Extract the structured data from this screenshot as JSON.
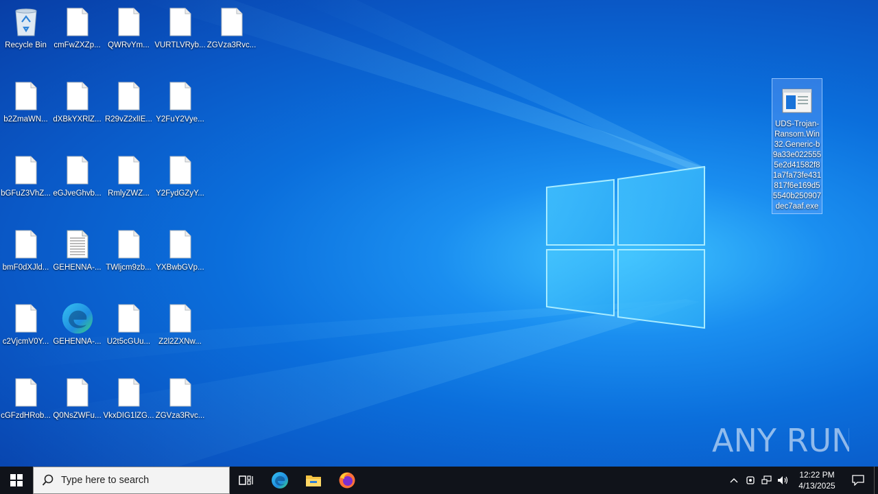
{
  "desktop": {
    "icons": [
      {
        "label": "Recycle Bin",
        "type": "recycle"
      },
      {
        "label": "cmFwZXZp...",
        "type": "file"
      },
      {
        "label": "QWRvYm...",
        "type": "file"
      },
      {
        "label": "VURTLVRyb...",
        "type": "file"
      },
      {
        "label": "ZGVza3Rvc...",
        "type": "file"
      },
      {
        "label": "b2ZmaWN...",
        "type": "file"
      },
      {
        "label": "dXBkYXRlZ...",
        "type": "file"
      },
      {
        "label": "R29vZ2xlIE...",
        "type": "file"
      },
      {
        "label": "Y2FuY2Vye...",
        "type": "file"
      },
      {
        "label": "bGFuZ3VhZ...",
        "type": "file"
      },
      {
        "label": "eGJveGhvb...",
        "type": "file"
      },
      {
        "label": "RmlyZWZ...",
        "type": "file"
      },
      {
        "label": "Y2FydGZyY...",
        "type": "file"
      },
      {
        "label": "bmF0dXJld...",
        "type": "file"
      },
      {
        "label": "GEHENNA-...",
        "type": "text"
      },
      {
        "label": "TWljcm9zb...",
        "type": "file"
      },
      {
        "label": "YXBwbGVp...",
        "type": "file"
      },
      {
        "label": "c2VjcmV0Y...",
        "type": "file"
      },
      {
        "label": "GEHENNA-...",
        "type": "edge"
      },
      {
        "label": "U2t5cGUu...",
        "type": "file"
      },
      {
        "label": "Z2l2ZXNw...",
        "type": "file"
      },
      {
        "label": "cGFzdHRob...",
        "type": "file"
      },
      {
        "label": "Q0NsZWFu...",
        "type": "file"
      },
      {
        "label": "VkxDIG1lZG...",
        "type": "file"
      },
      {
        "label": "ZGVza3Rvc...",
        "type": "file"
      }
    ],
    "selected_icon": {
      "label": "UDS-Trojan-Ransom.Win32.Generic-b9a33e0225555e2d41582f81a7fa73fe431817f6e169d55540b250907dec7aaf.exe",
      "type": "exe"
    },
    "watermark": "ANY RUN"
  },
  "taskbar": {
    "search_placeholder": "Type here to search",
    "pinned": [
      "task-view",
      "edge",
      "file-explorer",
      "firefox"
    ],
    "clock_time": "12:22 PM",
    "clock_date": "4/13/2025"
  },
  "colors": {
    "taskbar": "#10131a",
    "desktop_accent": "#0b6fdc"
  }
}
